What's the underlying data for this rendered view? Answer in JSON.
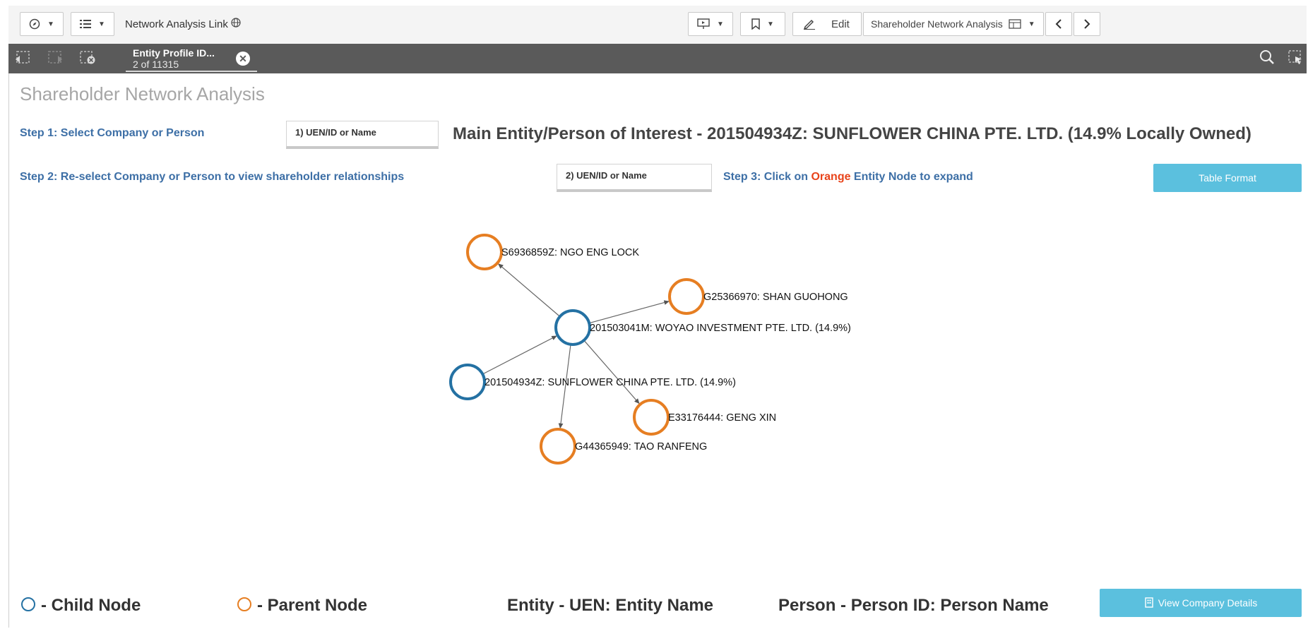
{
  "toolbar": {
    "app_title": "Network Analysis Link",
    "edit_label": "Edit",
    "sheet_selector": "Shareholder Network Analysis"
  },
  "selections": {
    "field": "Entity Profile ID...",
    "count": "2 of 11315"
  },
  "sheet": {
    "title": "Shareholder Network Analysis",
    "step1": "Step 1: Select Company or Person",
    "filter1_placeholder": "1) UEN/ID or Name",
    "main_entity": "Main Entity/Person of Interest - 201504934Z: SUNFLOWER CHINA PTE. LTD. (14.9% Locally Owned)",
    "step2": "Step 2: Re-select Company or Person to view shareholder relationships",
    "filter2_placeholder": "2) UEN/ID or Name",
    "step3_prefix": "Step 3: Click on ",
    "step3_highlight": "Orange",
    "step3_suffix": " Entity Node to expand",
    "table_format_button": "Table Format",
    "view_details_button": "View Company Details"
  },
  "network": {
    "nodes": [
      {
        "id": "n1",
        "label": "S6936859Z: NGO ENG LOCK",
        "type": "parent"
      },
      {
        "id": "n2",
        "label": "G25366970: SHAN GUOHONG",
        "type": "parent"
      },
      {
        "id": "n3",
        "label": "201503041M: WOYAO INVESTMENT PTE. LTD. (14.9%)",
        "type": "child"
      },
      {
        "id": "n4",
        "label": "201504934Z: SUNFLOWER CHINA PTE. LTD. (14.9%)",
        "type": "child"
      },
      {
        "id": "n5",
        "label": "E33176444: GENG XIN",
        "type": "parent"
      },
      {
        "id": "n6",
        "label": "G44365949: TAO RANFENG",
        "type": "parent"
      }
    ],
    "edges": [
      {
        "from": "n3",
        "to": "n1"
      },
      {
        "from": "n3",
        "to": "n2"
      },
      {
        "from": "n4",
        "to": "n3"
      },
      {
        "from": "n3",
        "to": "n5"
      },
      {
        "from": "n3",
        "to": "n6"
      }
    ]
  },
  "legend": {
    "child_label": "- Child Node",
    "parent_label": "- Parent Node",
    "entity_format": "Entity - UEN: Entity Name",
    "person_format": "Person - Person ID: Person Name"
  },
  "colors": {
    "child_node": "#2471a3",
    "parent_node": "#e67e22",
    "step_text": "#3d6fa6",
    "accent_button": "#5bc0de",
    "highlight": "#e8431a"
  }
}
